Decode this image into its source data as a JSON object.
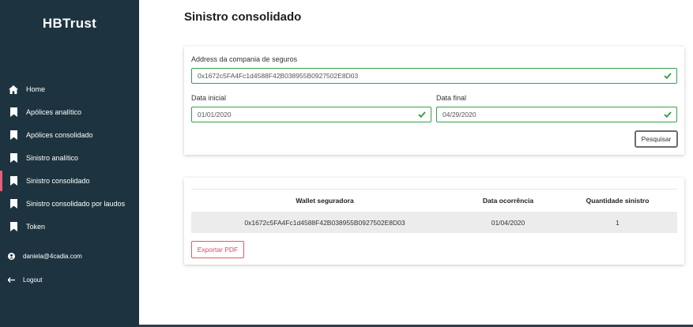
{
  "brand": {
    "logo": "HBTrust"
  },
  "sidebar": {
    "items": [
      {
        "label": "Home",
        "icon": "home-icon"
      },
      {
        "label": "Apólices analítico",
        "icon": "bookmark-icon"
      },
      {
        "label": "Apólices consolidado",
        "icon": "bookmark-icon"
      },
      {
        "label": "Sinistro analítico",
        "icon": "bookmark-icon"
      },
      {
        "label": "Sinistro consolidado",
        "icon": "bookmark-icon",
        "active": true
      },
      {
        "label": "Sinistro consolidado por laudos",
        "icon": "bookmark-icon"
      },
      {
        "label": "Token",
        "icon": "bookmark-icon"
      }
    ],
    "user_email": "daniela@4cadia.com",
    "logout": "Logout"
  },
  "page": {
    "title": "Sinistro consolidado"
  },
  "form": {
    "address_label": "Address da compania de seguros",
    "address_value": "0x1672c5FA4Fc1d4588F42B038955B0927502E8D03",
    "start_label": "Data inicial",
    "start_value": "01/01/2020",
    "end_label": "Data final",
    "end_value": "04/29/2020",
    "search_label": "Pesquisar"
  },
  "results": {
    "headers": [
      "Wallet seguradora",
      "Data ocorrência",
      "Quantidade sinistro"
    ],
    "rows": [
      [
        "0x1672c5FA4Fc1d4588F42B038955B0927502E8D03",
        "01/04/2020",
        "1"
      ]
    ],
    "export_label": "Exportar PDF"
  },
  "colors": {
    "sidebar_bg": "#1d3440",
    "active_accent": "#e0607e",
    "valid_green": "#38a04a",
    "export_red": "#d94a5c"
  }
}
